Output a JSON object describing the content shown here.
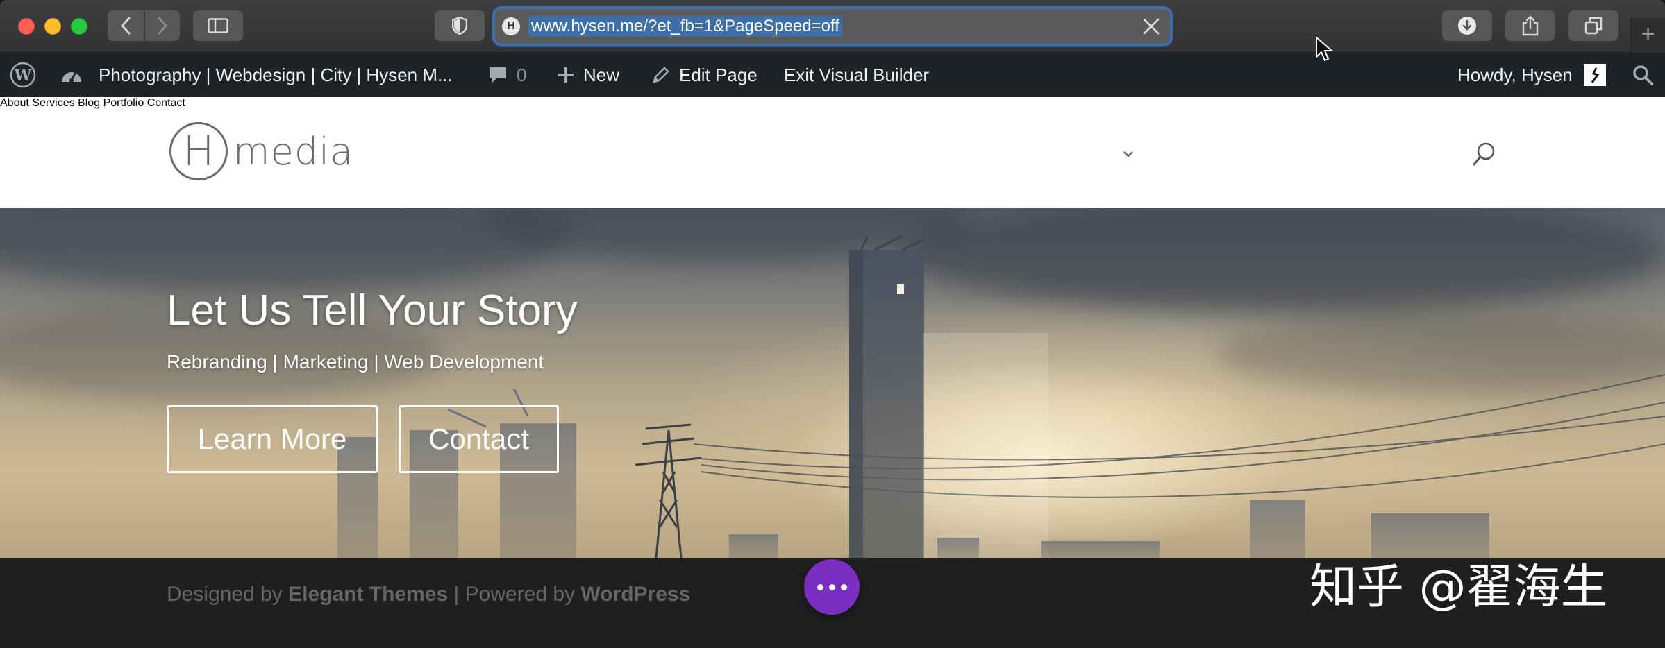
{
  "browser": {
    "url": "www.hysen.me/?et_fb=1&PageSpeed=off",
    "favicon_letter": "H",
    "new_tab_label": "+"
  },
  "adminbar": {
    "site_title": "Photography | Webdesign | City | Hysen M...",
    "comments_count": "0",
    "new_label": "New",
    "edit_label": "Edit Page",
    "exit_label": "Exit Visual Builder",
    "howdy": "Howdy, Hysen"
  },
  "header": {
    "logo_letter": "H",
    "logo_word": "media",
    "nav": [
      {
        "label": "About"
      },
      {
        "label": "Services"
      },
      {
        "label": "Blog"
      },
      {
        "label": "Portfolio"
      },
      {
        "label": "Contact"
      }
    ]
  },
  "hero": {
    "title": "Let Us Tell Your Story",
    "subtitle": "Rebranding | Marketing | Web Development",
    "buttons": [
      {
        "label": "Learn More"
      },
      {
        "label": "Contact"
      }
    ]
  },
  "footer": {
    "designed_by": "Designed by ",
    "theme_name": "Elegant Themes",
    "powered_by": " | Powered by ",
    "cms_name": "WordPress"
  },
  "watermark": "知乎 @翟海生",
  "colors": {
    "accent_purple": "#7b2fc2",
    "admin_bar": "#1d2327",
    "url_highlight": "#3f6fa8"
  },
  "icons": [
    "back-arrow-icon",
    "forward-arrow-icon",
    "sidebar-icon",
    "shield-icon",
    "clear-icon",
    "download-icon",
    "share-icon",
    "tabs-icon",
    "wordpress-icon",
    "dashboard-icon",
    "comment-icon",
    "plus-icon",
    "pencil-icon",
    "avatar",
    "search-icon",
    "chevron-down-icon",
    "more-dots-icon"
  ]
}
